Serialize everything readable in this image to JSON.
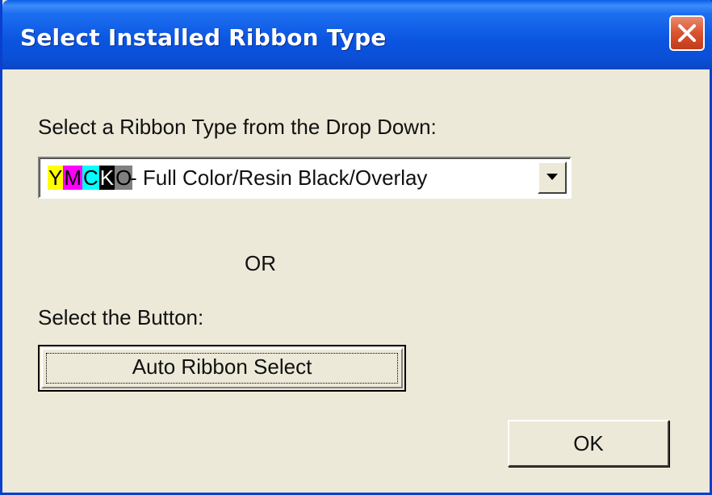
{
  "window": {
    "title": "Select Installed Ribbon Type"
  },
  "dialog": {
    "dropdown_prompt": "Select a Ribbon Type from the Drop Down:",
    "ribbon_select": {
      "code_letters": [
        "Y",
        "M",
        "C",
        "K",
        "O"
      ],
      "code_colors": [
        "#ffff00",
        "#ff00ff",
        "#00ffff",
        "#000000",
        "#808080"
      ],
      "selected_description": " - Full Color/Resin Black/Overlay"
    },
    "or_text": "OR",
    "button_prompt": "Select the Button:",
    "auto_button_label": "Auto Ribbon Select",
    "ok_label": "OK"
  },
  "icons": {
    "close": "close-icon",
    "dropdown": "chevron-down-icon"
  }
}
